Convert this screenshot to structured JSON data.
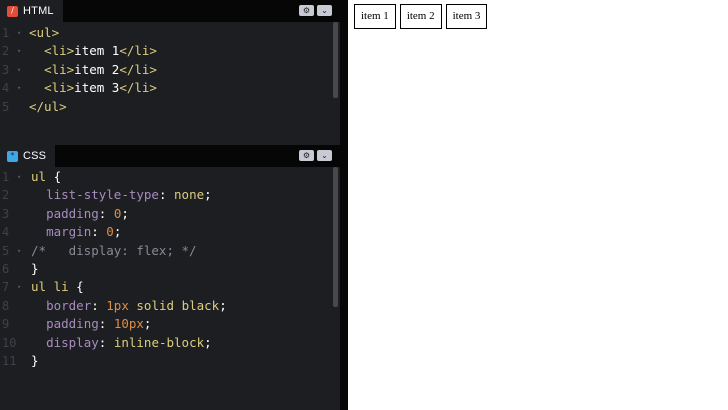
{
  "html_pane": {
    "tab_label": "HTML",
    "icon": "html-icon",
    "lines": [
      {
        "n": "1",
        "fold": "▾",
        "parts": [
          [
            "tag",
            "<ul>"
          ]
        ]
      },
      {
        "n": "2",
        "fold": "▾",
        "parts": [
          [
            "punc",
            "  "
          ],
          [
            "tag",
            "<li>"
          ],
          [
            "punc",
            "item 1"
          ],
          [
            "tag",
            "</li>"
          ]
        ]
      },
      {
        "n": "3",
        "fold": "▾",
        "parts": [
          [
            "punc",
            "  "
          ],
          [
            "tag",
            "<li>"
          ],
          [
            "punc",
            "item 2"
          ],
          [
            "tag",
            "</li>"
          ]
        ]
      },
      {
        "n": "4",
        "fold": "▾",
        "parts": [
          [
            "punc",
            "  "
          ],
          [
            "tag",
            "<li>"
          ],
          [
            "punc",
            "item 3"
          ],
          [
            "tag",
            "</li>"
          ]
        ]
      },
      {
        "n": "5",
        "fold": "",
        "parts": [
          [
            "tag",
            "</ul>"
          ]
        ]
      }
    ]
  },
  "css_pane": {
    "tab_label": "CSS",
    "icon": "css-icon",
    "lines": [
      {
        "n": "1",
        "fold": "▾",
        "parts": [
          [
            "sel",
            "ul "
          ],
          [
            "punc",
            "{"
          ]
        ]
      },
      {
        "n": "2",
        "fold": "",
        "parts": [
          [
            "punc",
            "  "
          ],
          [
            "prop",
            "list-style-type"
          ],
          [
            "punc",
            ": "
          ],
          [
            "kw",
            "none"
          ],
          [
            "punc",
            ";"
          ]
        ]
      },
      {
        "n": "3",
        "fold": "",
        "parts": [
          [
            "punc",
            "  "
          ],
          [
            "prop",
            "padding"
          ],
          [
            "punc",
            ": "
          ],
          [
            "num",
            "0"
          ],
          [
            "punc",
            ";"
          ]
        ]
      },
      {
        "n": "4",
        "fold": "",
        "parts": [
          [
            "punc",
            "  "
          ],
          [
            "prop",
            "margin"
          ],
          [
            "punc",
            ": "
          ],
          [
            "num",
            "0"
          ],
          [
            "punc",
            ";"
          ]
        ]
      },
      {
        "n": "5",
        "fold": "▾",
        "parts": [
          [
            "cmt",
            "/*   display: flex; */"
          ]
        ]
      },
      {
        "n": "6",
        "fold": "",
        "parts": [
          [
            "punc",
            "}"
          ]
        ]
      },
      {
        "n": "7",
        "fold": "▾",
        "parts": [
          [
            "sel",
            "ul li "
          ],
          [
            "punc",
            "{"
          ]
        ]
      },
      {
        "n": "8",
        "fold": "",
        "parts": [
          [
            "punc",
            "  "
          ],
          [
            "prop",
            "border"
          ],
          [
            "punc",
            ": "
          ],
          [
            "num",
            "1px"
          ],
          [
            "punc",
            " "
          ],
          [
            "kw",
            "solid"
          ],
          [
            "punc",
            " "
          ],
          [
            "kw",
            "black"
          ],
          [
            "punc",
            ";"
          ]
        ]
      },
      {
        "n": "9",
        "fold": "",
        "parts": [
          [
            "punc",
            "  "
          ],
          [
            "prop",
            "padding"
          ],
          [
            "punc",
            ": "
          ],
          [
            "num",
            "10px"
          ],
          [
            "punc",
            ";"
          ]
        ]
      },
      {
        "n": "10",
        "fold": "",
        "parts": [
          [
            "punc",
            "  "
          ],
          [
            "prop",
            "display"
          ],
          [
            "punc",
            ": "
          ],
          [
            "kw",
            "inline-block"
          ],
          [
            "punc",
            ";"
          ]
        ]
      },
      {
        "n": "11",
        "fold": "",
        "parts": [
          [
            "punc",
            "}"
          ]
        ]
      }
    ]
  },
  "pane_buttons": {
    "settings": "⚙",
    "collapse": "⌄"
  },
  "preview": {
    "items": [
      "item 1",
      "item 2",
      "item 3"
    ]
  },
  "colors": {
    "editor_bg": "#1d1e22",
    "header_bg": "#060606",
    "tag": "#dbcd7d",
    "property": "#a88cbf",
    "number": "#e08c43",
    "comment": "#888a94"
  }
}
